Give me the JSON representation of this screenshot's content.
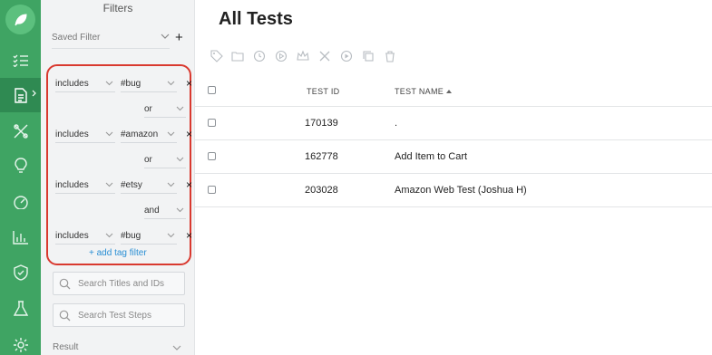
{
  "panel": {
    "title": "Filters",
    "saved_filter_placeholder": "Saved Filter",
    "add_saved": "+",
    "rows": [
      {
        "op": "includes",
        "tag": "#bug"
      },
      {
        "op": "includes",
        "tag": "#amazon"
      },
      {
        "op": "includes",
        "tag": "#etsy"
      },
      {
        "op": "includes",
        "tag": "#bug"
      }
    ],
    "conjunctions": [
      "or",
      "or",
      "and"
    ],
    "remove": "×",
    "add_tag_filter": "+ add tag filter",
    "search_titles_placeholder": "Search Titles and IDs",
    "search_steps_placeholder": "Search Test Steps",
    "result_label": "Result"
  },
  "main": {
    "title": "All Tests",
    "columns": {
      "id": "TEST ID",
      "name": "TEST NAME"
    },
    "rows": [
      {
        "id": "170139",
        "name": "."
      },
      {
        "id": "162778",
        "name": "Add Item to Cart"
      },
      {
        "id": "203028",
        "name": "Amazon Web Test (Joshua H)"
      }
    ]
  },
  "colors": {
    "rail": "#3fa463",
    "highlight": "#d9392f",
    "link": "#2a8fd4"
  },
  "icons": [
    "leaf-logo-icon",
    "checklist-icon",
    "document-icon",
    "tools-icon",
    "lightbulb-icon",
    "dashboard-gauge-icon",
    "bar-chart-icon",
    "shield-check-icon",
    "flask-icon",
    "gear-icon"
  ]
}
